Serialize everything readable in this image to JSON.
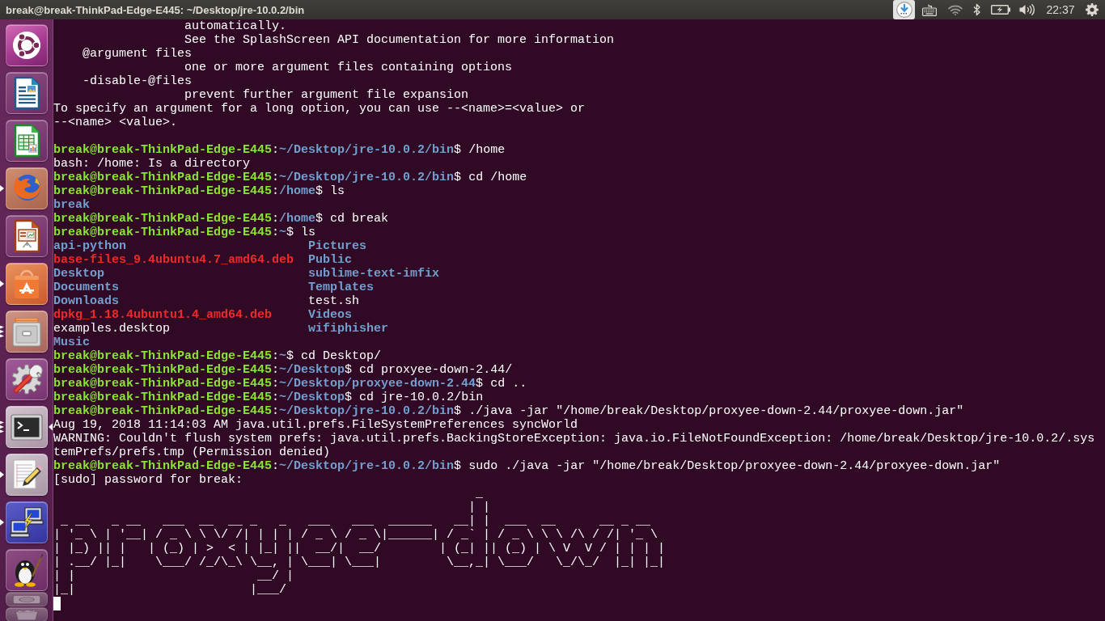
{
  "top_bar": {
    "title": "break@break-ThinkPad-Edge-E445: ~/Desktop/jre-10.0.2/bin",
    "indicators": [
      {
        "kind": "download",
        "highlighted": true
      },
      {
        "kind": "keyboard",
        "highlighted": false
      },
      {
        "kind": "network",
        "highlighted": false
      },
      {
        "kind": "bluetooth",
        "highlighted": false
      },
      {
        "kind": "battery",
        "highlighted": false
      },
      {
        "kind": "volume",
        "highlighted": false
      },
      {
        "kind": "clock",
        "highlighted": false,
        "text": "22:37"
      },
      {
        "kind": "session",
        "highlighted": false
      }
    ]
  },
  "launcher": {
    "items": [
      {
        "kind": "dash",
        "running": false,
        "multiple_windows": false,
        "focused": false,
        "folded": false
      },
      {
        "kind": "document",
        "running": false,
        "multiple_windows": false,
        "focused": false,
        "folded": false
      },
      {
        "kind": "spreadsheet",
        "running": false,
        "multiple_windows": false,
        "focused": false,
        "folded": false
      },
      {
        "kind": "browser",
        "running": true,
        "multiple_windows": false,
        "focused": false,
        "folded": false
      },
      {
        "kind": "presentation",
        "running": false,
        "multiple_windows": false,
        "focused": false,
        "folded": false
      },
      {
        "kind": "store",
        "running": true,
        "multiple_windows": false,
        "focused": false,
        "folded": false
      },
      {
        "kind": "files",
        "running": true,
        "multiple_windows": true,
        "focused": false,
        "folded": false
      },
      {
        "kind": "settings",
        "running": false,
        "multiple_windows": false,
        "focused": false,
        "folded": false
      },
      {
        "kind": "terminal",
        "running": true,
        "multiple_windows": true,
        "focused": true,
        "folded": false
      },
      {
        "kind": "editor",
        "running": true,
        "multiple_windows": false,
        "focused": false,
        "folded": false
      },
      {
        "kind": "network",
        "running": true,
        "multiple_windows": false,
        "focused": false,
        "folded": false
      },
      {
        "kind": "penguin",
        "running": false,
        "multiple_windows": false,
        "focused": false,
        "folded": false
      },
      {
        "kind": "drive",
        "running": false,
        "multiple_windows": false,
        "focused": false,
        "folded": true
      },
      {
        "kind": "trash",
        "running": false,
        "multiple_windows": false,
        "focused": false,
        "folded": true
      }
    ]
  },
  "terminal": {
    "lines": [
      {
        "kind": "output",
        "text": "                  automatically."
      },
      {
        "kind": "output",
        "text": "                  See the SplashScreen API documentation for more information"
      },
      {
        "kind": "output",
        "text": "    @argument files"
      },
      {
        "kind": "output",
        "text": "                  one or more argument files containing options"
      },
      {
        "kind": "output",
        "text": "    -disable-@files"
      },
      {
        "kind": "output",
        "text": "                  prevent further argument file expansion"
      },
      {
        "kind": "output",
        "text": "To specify an argument for a long option, you can use --<name>=<value> or"
      },
      {
        "kind": "output",
        "text": "--<name> <value>."
      },
      {
        "kind": "blank"
      },
      {
        "kind": "prompt",
        "user": "break@break-ThinkPad-Edge-E445",
        "separator": ":",
        "path": "~/Desktop/jre-10.0.2/bin",
        "symbol": "$",
        "command": "/home"
      },
      {
        "kind": "output",
        "text": "bash: /home: Is a directory"
      },
      {
        "kind": "prompt",
        "user": "break@break-ThinkPad-Edge-E445",
        "separator": ":",
        "path": "~/Desktop/jre-10.0.2/bin",
        "symbol": "$",
        "command": "cd /home"
      },
      {
        "kind": "prompt",
        "user": "break@break-ThinkPad-Edge-E445",
        "separator": ":",
        "path": "/home",
        "symbol": "$",
        "command": "ls"
      },
      {
        "kind": "listing",
        "entries": [
          {
            "name": "break",
            "kind": "directory"
          }
        ]
      },
      {
        "kind": "prompt",
        "user": "break@break-ThinkPad-Edge-E445",
        "separator": ":",
        "path": "/home",
        "symbol": "$",
        "command": "cd break"
      },
      {
        "kind": "prompt",
        "user": "break@break-ThinkPad-Edge-E445",
        "separator": ":",
        "path": "~",
        "symbol": "$",
        "command": "ls"
      },
      {
        "kind": "listing",
        "entries": [
          {
            "name": "api-python",
            "kind": "directory"
          },
          {
            "name": "Pictures",
            "kind": "directory"
          }
        ]
      },
      {
        "kind": "listing",
        "entries": [
          {
            "name": "base-files_9.4ubuntu4.7_amd64.deb",
            "kind": "package"
          },
          {
            "name": "Public",
            "kind": "directory"
          }
        ]
      },
      {
        "kind": "listing",
        "entries": [
          {
            "name": "Desktop",
            "kind": "directory"
          },
          {
            "name": "sublime-text-imfix",
            "kind": "directory"
          }
        ]
      },
      {
        "kind": "listing",
        "entries": [
          {
            "name": "Documents",
            "kind": "directory"
          },
          {
            "name": "Templates",
            "kind": "directory"
          }
        ]
      },
      {
        "kind": "listing",
        "entries": [
          {
            "name": "Downloads",
            "kind": "directory"
          },
          {
            "name": "test.sh",
            "kind": "file"
          }
        ]
      },
      {
        "kind": "listing",
        "entries": [
          {
            "name": "dpkg_1.18.4ubuntu1.4_amd64.deb",
            "kind": "package"
          },
          {
            "name": "Videos",
            "kind": "directory"
          }
        ]
      },
      {
        "kind": "listing",
        "entries": [
          {
            "name": "examples.desktop",
            "kind": "file"
          },
          {
            "name": "wifiphisher",
            "kind": "directory"
          }
        ]
      },
      {
        "kind": "listing",
        "entries": [
          {
            "name": "Music",
            "kind": "directory"
          }
        ]
      },
      {
        "kind": "prompt",
        "user": "break@break-ThinkPad-Edge-E445",
        "separator": ":",
        "path": "~",
        "symbol": "$",
        "command": "cd Desktop/"
      },
      {
        "kind": "prompt",
        "user": "break@break-ThinkPad-Edge-E445",
        "separator": ":",
        "path": "~/Desktop",
        "symbol": "$",
        "command": "cd proxyee-down-2.44/"
      },
      {
        "kind": "prompt",
        "user": "break@break-ThinkPad-Edge-E445",
        "separator": ":",
        "path": "~/Desktop/proxyee-down-2.44",
        "symbol": "$",
        "command": "cd .."
      },
      {
        "kind": "prompt",
        "user": "break@break-ThinkPad-Edge-E445",
        "separator": ":",
        "path": "~/Desktop",
        "symbol": "$",
        "command": "cd jre-10.0.2/bin"
      },
      {
        "kind": "prompt",
        "user": "break@break-ThinkPad-Edge-E445",
        "separator": ":",
        "path": "~/Desktop/jre-10.0.2/bin",
        "symbol": "$",
        "command": "./java -jar \"/home/break/Desktop/proxyee-down-2.44/proxyee-down.jar\""
      },
      {
        "kind": "output",
        "text": "Aug 19, 2018 11:14:03 AM java.util.prefs.FileSystemPreferences syncWorld"
      },
      {
        "kind": "output",
        "text": "WARNING: Couldn't flush system prefs: java.util.prefs.BackingStoreException: java.io.FileNotFoundException: /home/break/Desktop/jre-10.0.2/.sys"
      },
      {
        "kind": "output",
        "text": "temPrefs/prefs.tmp (Permission denied)"
      },
      {
        "kind": "prompt",
        "user": "break@break-ThinkPad-Edge-E445",
        "separator": ":",
        "path": "~/Desktop/jre-10.0.2/bin",
        "symbol": "$",
        "command": "sudo ./java -jar \"/home/break/Desktop/proxyee-down-2.44/proxyee-down.jar\""
      },
      {
        "kind": "output",
        "text": "[sudo] password for break:"
      },
      {
        "kind": "output",
        "text": "                                                          _"
      },
      {
        "kind": "output",
        "text": "                                                         | |"
      },
      {
        "kind": "output",
        "text": " _ __   _ __   ___  __  __ _   _   ___   ___  ______   __| |  ___  __      __ _ __"
      },
      {
        "kind": "output",
        "text": "| '_ \\ | '__| / _ \\ \\ \\/ /| | | | / _ \\ / _ \\|______| / _` | / _ \\ \\ \\ /\\ / /| '_ \\"
      },
      {
        "kind": "output",
        "text": "| |_) || |   | (_) | >  < | |_| ||  __/|  __/        | (_| || (_) | \\ V  V / | | | |"
      },
      {
        "kind": "output",
        "text": "| .__/ |_|    \\___/ /_/\\_\\ \\__, | \\___| \\___|         \\__,_| \\___/   \\_/\\_/  |_| |_|"
      },
      {
        "kind": "output",
        "text": "| |                         __/ |"
      },
      {
        "kind": "output",
        "text": "|_|                        |___/"
      }
    ],
    "cursor_visible": true
  }
}
